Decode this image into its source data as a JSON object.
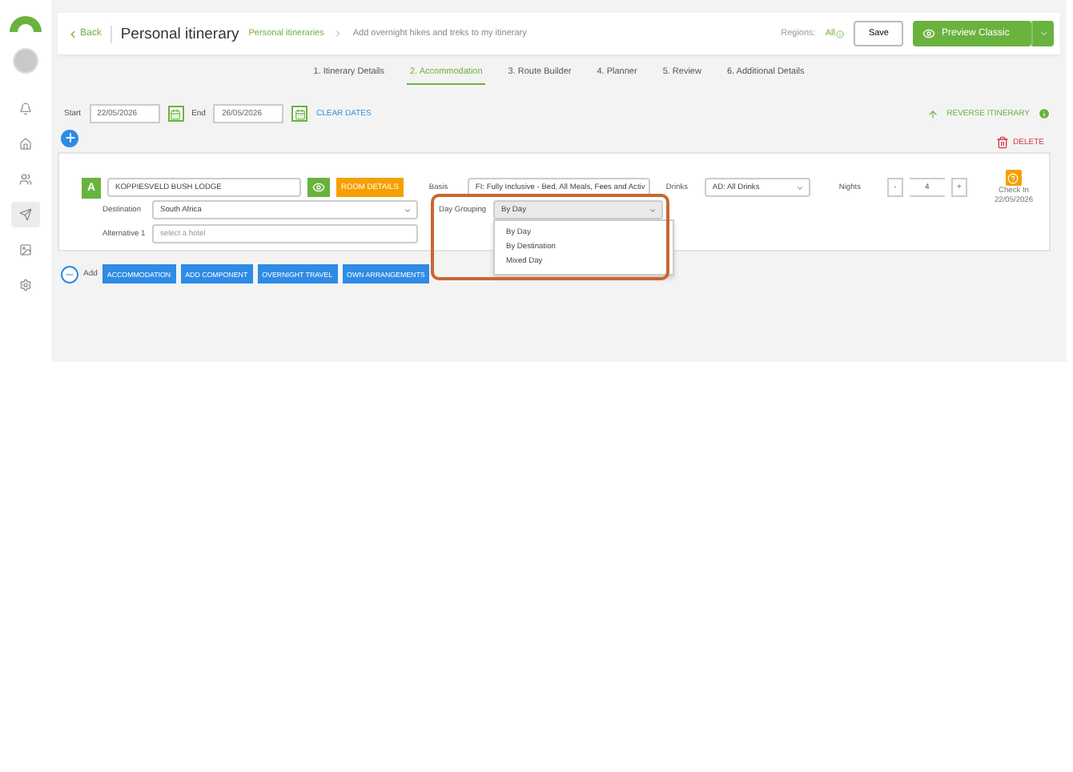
{
  "sidebar": {
    "items": [
      {
        "kind": "bell",
        "selected": false
      },
      {
        "kind": "home",
        "selected": false
      },
      {
        "kind": "users",
        "selected": false
      },
      {
        "kind": "send",
        "selected": true
      },
      {
        "kind": "image",
        "selected": false
      },
      {
        "kind": "settings",
        "selected": false
      }
    ]
  },
  "header": {
    "back": "Back",
    "title": "Personal itinerary",
    "breadcrumb": [
      "Personal itineraries",
      "Add overnight hikes and treks to my itinerary"
    ],
    "regions_label": "Regions:",
    "regions_value": "All",
    "save": "Save",
    "preview": "Preview Classic"
  },
  "steps": [
    {
      "label": "1. Itinerary Details",
      "selected": false
    },
    {
      "label": "2. Accommodation",
      "selected": true
    },
    {
      "label": "3. Route Builder",
      "selected": false
    },
    {
      "label": "4. Planner",
      "selected": false
    },
    {
      "label": "5. Review",
      "selected": false
    },
    {
      "label": "6. Additional Details",
      "selected": false
    }
  ],
  "dates": {
    "start_label": "Start",
    "start": "22/05/2026",
    "end_label": "End",
    "end": "26/05/2026",
    "clear": "CLEAR DATES",
    "reverse": "REVERSE ITINERARY"
  },
  "delete": "DELETE",
  "stay": {
    "badge": "A",
    "hotel": "KOPPIESVELD BUSH LODGE",
    "room_details": "ROOM DETAILS",
    "basis_label": "Basis",
    "basis": "FI: Fully Inclusive - Bed, All Meals, Fees and Activ",
    "drinks_label": "Drinks",
    "drinks": "AD: All Drinks",
    "nights_label": "Nights",
    "nights": "4",
    "decrement": "-",
    "increment": "+",
    "check_in_label": "Check In",
    "check_in": "22/05/2026",
    "destination_label": "Destination",
    "destination": "South Africa",
    "alternative_label": "Alternative 1",
    "alternative_placeholder": "select a hotel",
    "day_grouping_label": "Day Grouping",
    "day_grouping": "By Day",
    "day_grouping_open": true,
    "day_grouping_options": [
      {
        "label": "By Day",
        "selected": false
      },
      {
        "label": "By Destination",
        "selected": false
      },
      {
        "label": "Mixed Day",
        "selected": false
      }
    ]
  },
  "add": {
    "label": "Add",
    "buttons": [
      "ACCOMMODATION",
      "ADD COMPONENT",
      "OVERNIGHT TRAVEL",
      "OWN ARRANGEMENTS"
    ]
  }
}
